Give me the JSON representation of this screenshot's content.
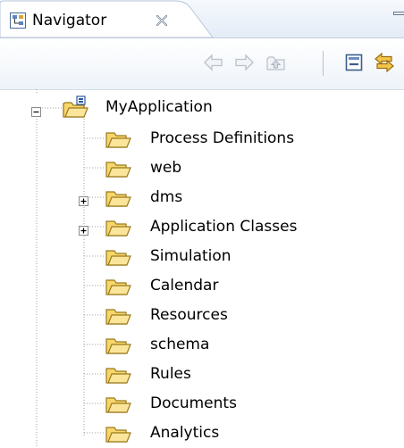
{
  "view": {
    "tab_title": "Navigator",
    "icons": {
      "tab": "navigator-icon",
      "close": "close-icon",
      "minimize": "minimize-icon"
    }
  },
  "toolbar": {
    "buttons": [
      {
        "name": "back-button",
        "icon": "back-arrow-icon",
        "enabled": false
      },
      {
        "name": "forward-button",
        "icon": "forward-arrow-icon",
        "enabled": false
      },
      {
        "name": "up-button",
        "icon": "up-folder-icon",
        "enabled": false
      },
      {
        "name": "collapse-all-button",
        "icon": "collapse-all-icon",
        "enabled": true
      },
      {
        "name": "link-with-editor-button",
        "icon": "link-editor-icon",
        "enabled": true
      }
    ]
  },
  "tree": {
    "root": {
      "label": "MyApplication",
      "expanded": true,
      "icon": "project-folder-icon"
    },
    "children": [
      {
        "label": "Process Definitions",
        "expandable": false,
        "icon": "folder-icon"
      },
      {
        "label": "web",
        "expandable": false,
        "icon": "folder-icon"
      },
      {
        "label": "dms",
        "expandable": true,
        "expanded": false,
        "icon": "folder-icon"
      },
      {
        "label": "Application Classes",
        "expandable": true,
        "expanded": false,
        "icon": "folder-icon"
      },
      {
        "label": "Simulation",
        "expandable": false,
        "icon": "folder-icon"
      },
      {
        "label": "Calendar",
        "expandable": false,
        "icon": "folder-icon"
      },
      {
        "label": "Resources",
        "expandable": false,
        "icon": "folder-icon"
      },
      {
        "label": "schema",
        "expandable": false,
        "icon": "folder-icon"
      },
      {
        "label": "Rules",
        "expandable": false,
        "icon": "folder-icon"
      },
      {
        "label": "Documents",
        "expandable": false,
        "icon": "folder-icon"
      },
      {
        "label": "Analytics",
        "expandable": false,
        "icon": "folder-icon"
      }
    ]
  },
  "colors": {
    "folder_fill": "#f7d66b",
    "folder_stroke": "#9a7a1c",
    "tree_line": "#a0a0a0"
  }
}
